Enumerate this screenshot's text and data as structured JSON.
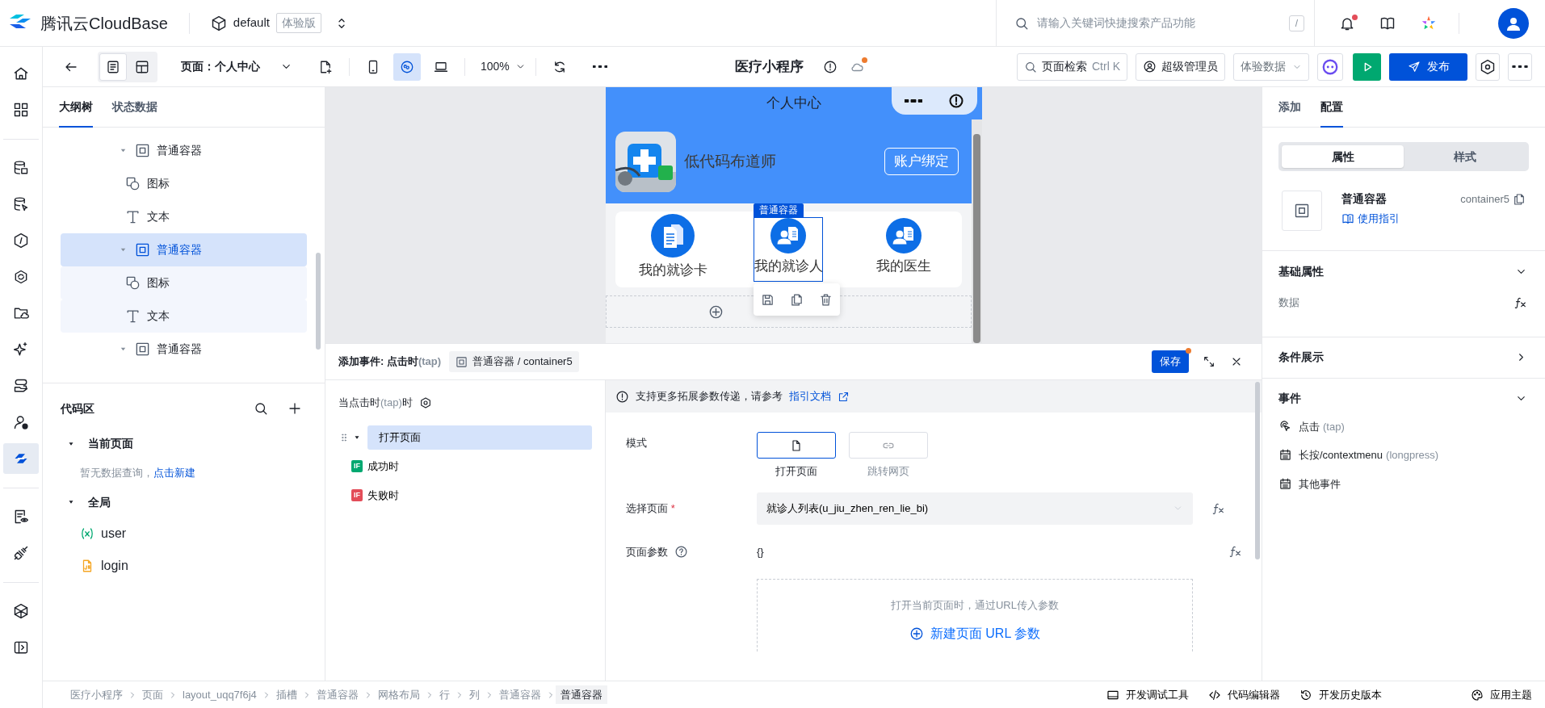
{
  "header": {
    "brand": "腾讯云CloudBase",
    "project": "default",
    "edition": "体验版",
    "search": {
      "placeholder": "请输入关键词快捷搜索产品功能",
      "shortcut": "/"
    },
    "notification_dot": true
  },
  "rail": {
    "groups": [
      [
        {
          "selected": false
        },
        {
          "selected": false
        }
      ],
      [
        {
          "selected": false
        },
        {
          "selected": false
        },
        {
          "selected": false
        },
        {
          "selected": false
        },
        {
          "selected": false
        },
        {
          "selected": false
        },
        {
          "selected": false
        },
        {
          "selected": false
        },
        {
          "selected": true
        }
      ],
      [
        {
          "selected": false
        },
        {
          "selected": false
        }
      ],
      [
        {
          "selected": false
        },
        {
          "selected": false
        }
      ]
    ]
  },
  "toolbar": {
    "view_modes": [
      {
        "selected": true
      },
      {
        "selected": false
      }
    ],
    "page_label": "页面：",
    "page": "个人中心",
    "devices": [
      {
        "selected": false
      },
      {
        "selected": true
      },
      {
        "selected": false
      }
    ],
    "zoom": "100%",
    "app_title": "医疗小程序",
    "cloud_dot": true,
    "page_search": "页面检索",
    "page_search_shortcut": "Ctrl K",
    "role": "超级管理员",
    "data_mode": "体验数据",
    "publish": "发布"
  },
  "outline": {
    "tabs": [
      {
        "label": "大纲树",
        "selected": true
      },
      {
        "label": "状态数据",
        "selected": false
      }
    ],
    "items": [
      {
        "kind": "container",
        "label": "普通容器",
        "expanded": true,
        "selected": false,
        "children": [
          {
            "kind": "icon",
            "label": "图标",
            "selected": false
          },
          {
            "kind": "text",
            "label": "文本",
            "selected": false
          }
        ]
      },
      {
        "kind": "container",
        "label": "普通容器",
        "expanded": true,
        "selected": true,
        "children": [
          {
            "kind": "icon",
            "label": "图标",
            "selected": false
          },
          {
            "kind": "text",
            "label": "文本",
            "selected": false
          }
        ]
      },
      {
        "kind": "container",
        "label": "普通容器",
        "expanded": true,
        "selected": false
      }
    ]
  },
  "code_area": {
    "title": "代码区",
    "groups": [
      {
        "label": "当前页面",
        "expanded": true,
        "empty_text": "暂无数据查询，",
        "empty_link": "点击新建"
      },
      {
        "label": "全局",
        "expanded": true,
        "items": [
          {
            "kind": "variable",
            "label": "user"
          },
          {
            "kind": "script",
            "label": "login"
          }
        ]
      }
    ]
  },
  "canvas": {
    "phone_title": "个人中心",
    "user_name": "低代码布道师",
    "bind_button": "账户绑定",
    "selection_tag": "普通容器",
    "menu": [
      {
        "kind": "card",
        "label": "我的就诊卡",
        "selected": false
      },
      {
        "kind": "person",
        "label": "我的就诊人",
        "selected": true
      },
      {
        "kind": "person",
        "label": "我的医生",
        "selected": false
      }
    ]
  },
  "event_panel": {
    "title": "添加事件: 点击时",
    "title_suffix": "(tap)",
    "target": "普通容器 / container5",
    "save": "保存",
    "unsaved_dot": true,
    "trigger": "当点击时",
    "trigger_suffix": "(tap)",
    "trigger_end": "时",
    "actions": [
      {
        "kind": "action",
        "label": "打开页面",
        "selected": true,
        "expanded": true
      },
      {
        "kind": "success",
        "badge": "IF",
        "label": "成功时",
        "selected": false
      },
      {
        "kind": "failure",
        "badge": "IF",
        "label": "失败时",
        "selected": false
      }
    ],
    "notice": "支持更多拓展参数传递，请参考",
    "notice_link": "指引文档",
    "mode_label": "模式",
    "modes": [
      {
        "kind": "page",
        "label": "打开页面",
        "selected": true
      },
      {
        "kind": "web",
        "label": "跳转网页",
        "selected": false
      }
    ],
    "page_label": "选择页面",
    "page_required_mark": "*",
    "page_value": "就诊人列表(u_jiu_zhen_ren_lie_bi)",
    "params_label": "页面参数",
    "params_value": "{}",
    "params_hint": "打开当前页面时，通过URL传入参数",
    "params_add": "新建页面 URL 参数"
  },
  "config_panel": {
    "tabs": [
      {
        "label": "添加",
        "selected": false
      },
      {
        "label": "配置",
        "selected": true
      }
    ],
    "segments": [
      {
        "label": "属性",
        "selected": true
      },
      {
        "label": "样式",
        "selected": false
      }
    ],
    "component": "普通容器",
    "component_id": "container5",
    "guide": "使用指引",
    "sections": [
      {
        "title": "基础属性",
        "expanded": true,
        "fields": [
          {
            "label": "数据"
          }
        ]
      },
      {
        "title": "条件展示",
        "expanded": false
      },
      {
        "title": "事件",
        "expanded": true,
        "events": [
          {
            "kind": "tap",
            "label": "点击",
            "suffix": "(tap)"
          },
          {
            "kind": "other",
            "label": "长按/contextmenu",
            "suffix": "(longpress)"
          },
          {
            "kind": "other",
            "label": "其他事件"
          }
        ]
      }
    ]
  },
  "breadcrumbs": [
    {
      "label": "医疗小程序",
      "selected": false
    },
    {
      "label": "页面",
      "selected": false
    },
    {
      "label": "layout_uqq7f6j4",
      "selected": false
    },
    {
      "label": "插槽",
      "selected": false
    },
    {
      "label": "普通容器",
      "selected": false
    },
    {
      "label": "网格布局",
      "selected": false
    },
    {
      "label": "行",
      "selected": false
    },
    {
      "label": "列",
      "selected": false
    },
    {
      "label": "普通容器",
      "selected": false
    },
    {
      "label": "普通容器",
      "selected": true
    }
  ],
  "bottom_tools": [
    "开发调试工具",
    "代码编辑器",
    "开发历史版本",
    "应用主题"
  ]
}
